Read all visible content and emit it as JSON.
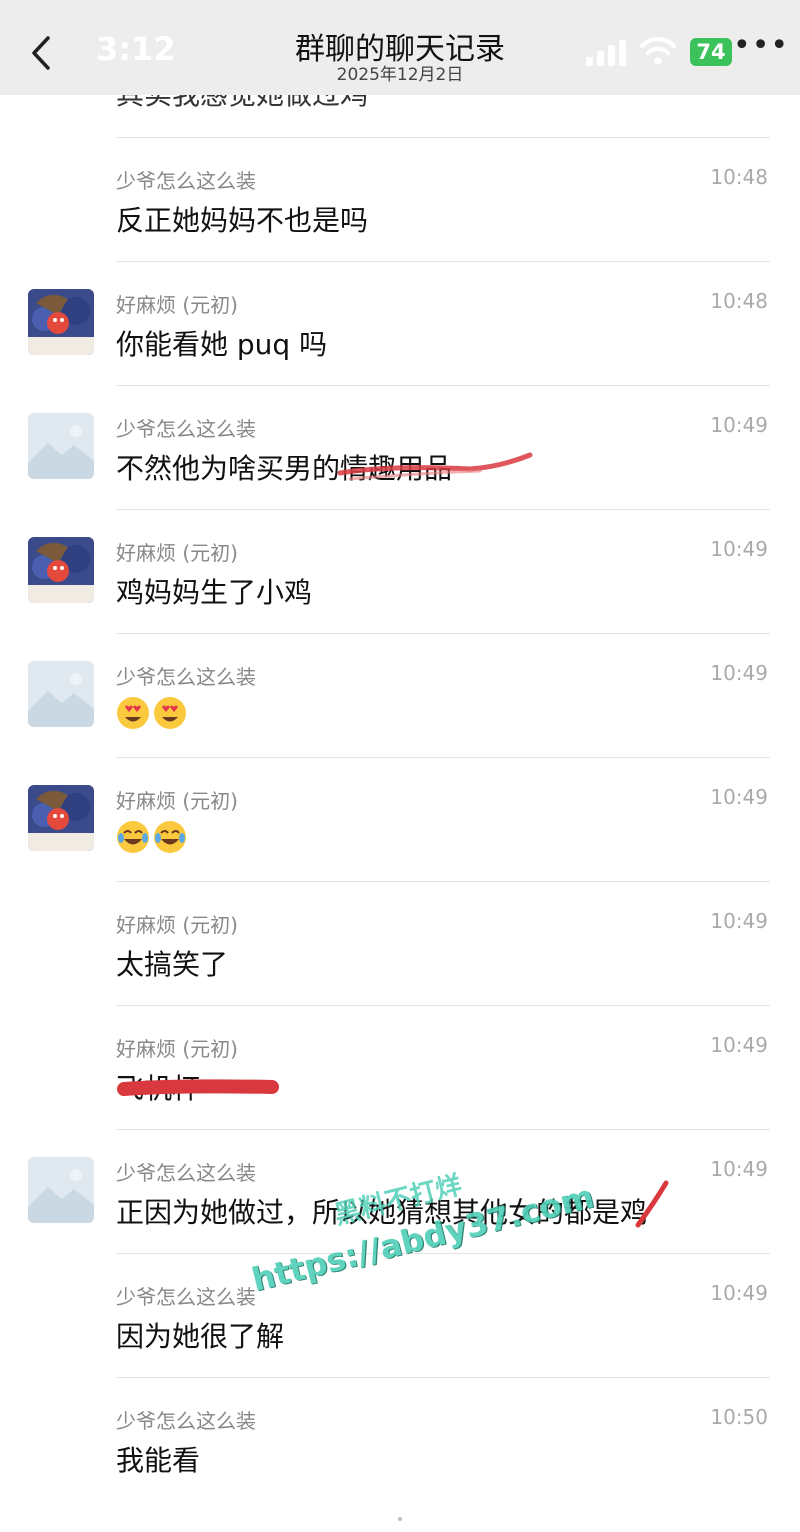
{
  "status": {
    "time": "3:12",
    "battery": "74"
  },
  "header": {
    "title": "群聊的聊天记录",
    "date": "2025年12月2日"
  },
  "partial_top": "其实我感觉她做过鸡",
  "messages": [
    {
      "sender": "少爷怎么这么装",
      "time": "10:48",
      "text": "反正她妈妈不也是吗"
    },
    {
      "sender": "好麻烦 (元初)",
      "time": "10:48",
      "text": "你能看她 puq 吗"
    },
    {
      "sender": "少爷怎么这么装",
      "time": "10:49",
      "text": "不然他为啥买男的情趣用品"
    },
    {
      "sender": "好麻烦 (元初)",
      "time": "10:49",
      "text": "鸡妈妈生了小鸡"
    },
    {
      "sender": "少爷怎么这么装",
      "time": "10:49",
      "text": "",
      "emoji": [
        "heart-eyes-emoji",
        "heart-eyes-emoji"
      ]
    },
    {
      "sender": "好麻烦 (元初)",
      "time": "10:49",
      "text": "",
      "emoji": [
        "laughing-tears-emoji",
        "laughing-tears-emoji"
      ]
    },
    {
      "sender": "好麻烦 (元初)",
      "time": "10:49",
      "text": "太搞笑了"
    },
    {
      "sender": "好麻烦 (元初)",
      "time": "10:49",
      "text": "飞机杯"
    },
    {
      "sender": "少爷怎么这么装",
      "time": "10:49",
      "text": "正因为她做过，所以她猜想其他女的都是鸡"
    },
    {
      "sender": "少爷怎么这么装",
      "time": "10:49",
      "text": "因为她很了解"
    },
    {
      "sender": "少爷怎么这么装",
      "time": "10:50",
      "text": "我能看"
    }
  ],
  "watermark": {
    "line1": "黑料不打烊",
    "line2": "https://abdy37.com"
  },
  "colors": {
    "battery": "#3cc25b",
    "scribble": "#d9383f",
    "watermark": "#52d0b8"
  }
}
